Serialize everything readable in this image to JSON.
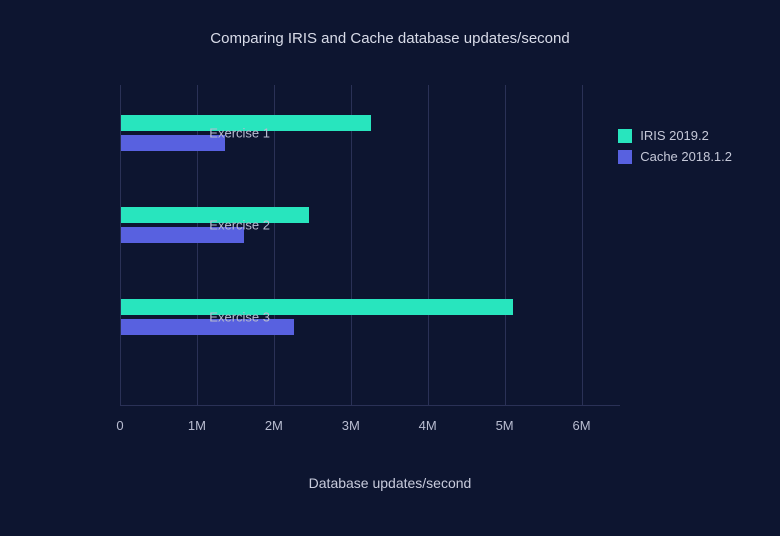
{
  "chart_data": {
    "type": "bar",
    "orientation": "horizontal",
    "title": "Comparing IRIS and Cache database updates/second",
    "xlabel": "Database updates/second",
    "ylabel": "",
    "categories": [
      "Exercise 1",
      "Exercise 2",
      "Exercise 3"
    ],
    "series": [
      {
        "name": "IRIS 2019.2",
        "color": "#28e5be",
        "values": [
          3250000,
          2450000,
          5100000
        ]
      },
      {
        "name": "Cache 2018.1.2",
        "color": "#5861e0",
        "values": [
          1350000,
          1600000,
          2250000
        ]
      }
    ],
    "xlim": [
      0,
      6500000
    ],
    "x_ticks": [
      0,
      1000000,
      2000000,
      3000000,
      4000000,
      5000000,
      6000000
    ],
    "x_tick_labels": [
      "0",
      "1M",
      "2M",
      "3M",
      "4M",
      "5M",
      "6M"
    ],
    "grid": true,
    "legend_position": "right"
  }
}
